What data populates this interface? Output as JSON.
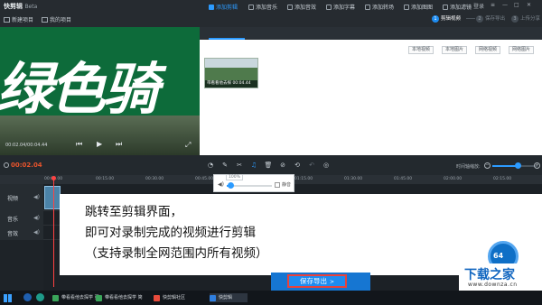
{
  "app": {
    "logo_text": "快剪辑",
    "beta_label": "Beta",
    "new_project": "新建项目",
    "my_projects": "我的项目",
    "login": "登录",
    "win_controls": [
      "≡",
      "—",
      "□",
      "✕"
    ]
  },
  "steps": [
    {
      "num": "1",
      "label": "剪辑视频",
      "active": true
    },
    {
      "num": "2",
      "label": "保存导出",
      "active": false
    },
    {
      "num": "3",
      "label": "上传分享",
      "active": false
    }
  ],
  "preview": {
    "overlay_text": "绿色骑",
    "time": "00:02.04/00:04.44",
    "play_controls": [
      "⏮",
      "▶",
      "⏭"
    ],
    "fullscreen_icon": "⤢"
  },
  "tabs": [
    {
      "label": "添加剪辑",
      "active": true
    },
    {
      "label": "添加音乐",
      "active": false
    },
    {
      "label": "添加音效",
      "active": false
    },
    {
      "label": "添加字幕",
      "active": false
    },
    {
      "label": "添加转场",
      "active": false
    },
    {
      "label": "添加图图",
      "active": false
    },
    {
      "label": "添加滤镜",
      "active": false
    }
  ],
  "add_buttons": [
    "本地视频",
    "本地图片",
    "网络视频",
    "网络图片"
  ],
  "clip_thumbnail": {
    "caption": "带看看他去探",
    "duration": "00:04.44"
  },
  "timeline": {
    "current_time": "00:02.04",
    "tools": [
      "◔",
      "✎",
      "✂",
      "♫",
      "🗑",
      "⊘",
      "⟲",
      "↶",
      "◎"
    ],
    "zoom_label": "时间轴缩放:",
    "zoom_level": 0.55,
    "ruler_ticks": [
      "00:00.00",
      "00:15.00",
      "00:30.00",
      "00:45.00",
      "01:00.00",
      "01:15.00",
      "01:30.00",
      "01:45.00",
      "02:00.00",
      "02:15.00"
    ]
  },
  "volume_popup": {
    "percent": "100%",
    "mute_label": "静音",
    "level": 0.08
  },
  "tracks": [
    {
      "name": "视频"
    },
    {
      "name": "音乐"
    },
    {
      "name": "音效"
    }
  ],
  "overlay_caption": [
    "跳转至剪辑界面，",
    "即可对录制完成的视频进行剪辑",
    "（支持录制全网范围内所有视频）"
  ],
  "export_button": {
    "label": "保存导出",
    "chevron": ">"
  },
  "help_ring": "64",
  "site_logo": {
    "main": "下载之家",
    "url": "www.downza.cn"
  },
  "taskbar": {
    "items": [
      {
        "label": "带看看他去探学 更",
        "color": "#3aa55a",
        "active": false
      },
      {
        "label": "带看看他去探学 简",
        "color": "#3aa55a",
        "active": false
      },
      {
        "label": "快剪辑社区",
        "color": "#e84b3c",
        "active": false
      },
      {
        "label": "快剪辑",
        "color": "#2f7fe0",
        "active": true
      }
    ]
  },
  "colors": {
    "accent": "#2c9bff",
    "export_outline": "#e8423c",
    "current_time": "#e8542c",
    "playhead": "#ff4242"
  }
}
